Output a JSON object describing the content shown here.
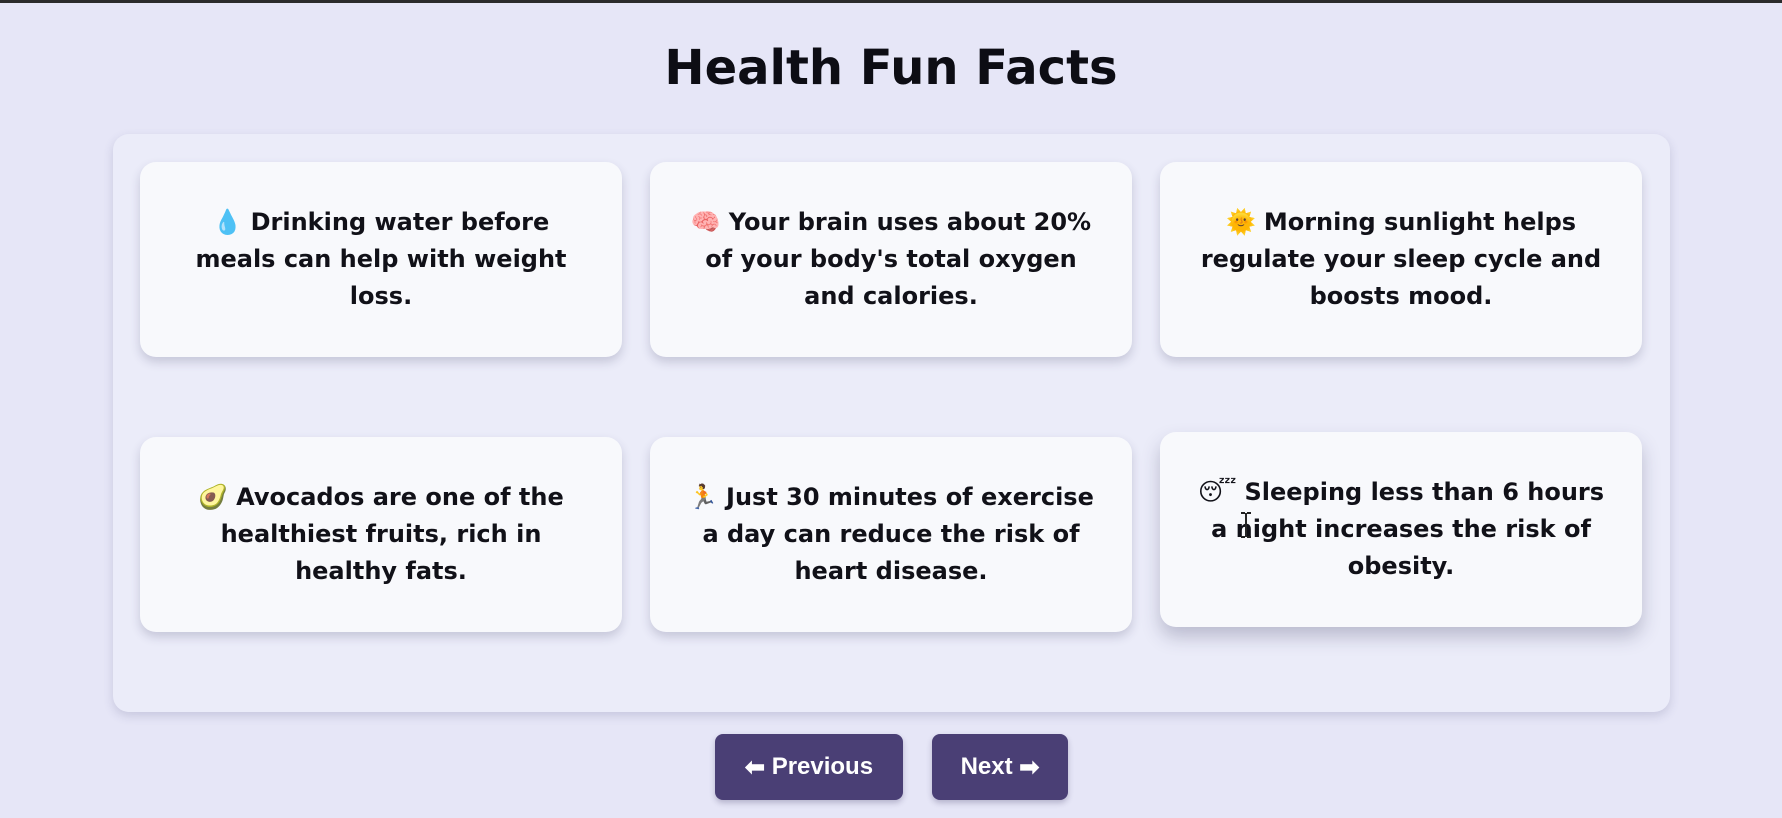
{
  "page": {
    "title": "Health Fun Facts"
  },
  "facts": [
    {
      "icon": "water-drop-icon",
      "emoji": "💧",
      "text": "Drinking water before meals can help with weight loss."
    },
    {
      "icon": "brain-icon",
      "emoji": "🧠",
      "text": "Your brain uses about 20% of your body's total oxygen and calories."
    },
    {
      "icon": "sun-icon",
      "emoji": "🌞",
      "text": "Morning sunlight helps regulate your sleep cycle and boosts mood."
    },
    {
      "icon": "avocado-icon",
      "emoji": "🥑",
      "text": "Avocados are one of the healthiest fruits, rich in healthy fats."
    },
    {
      "icon": "running-person-icon",
      "emoji": "🏃",
      "text": "Just 30 minutes of exercise a day can reduce the risk of heart disease."
    },
    {
      "icon": "sleeping-face-icon",
      "emoji": "😴",
      "text": "Sleeping less than 6 hours a night increases the risk of obesity."
    }
  ],
  "navigation": {
    "previous_label": "Previous",
    "previous_arrow": "⬅",
    "next_label": "Next",
    "next_arrow": "➡"
  },
  "colors": {
    "background": "#e6e6f7",
    "panel": "#ebecf9",
    "card": "#f8f9fc",
    "button": "#4a3f75",
    "button_text": "#ffffff",
    "title_text": "#0d0d14"
  }
}
